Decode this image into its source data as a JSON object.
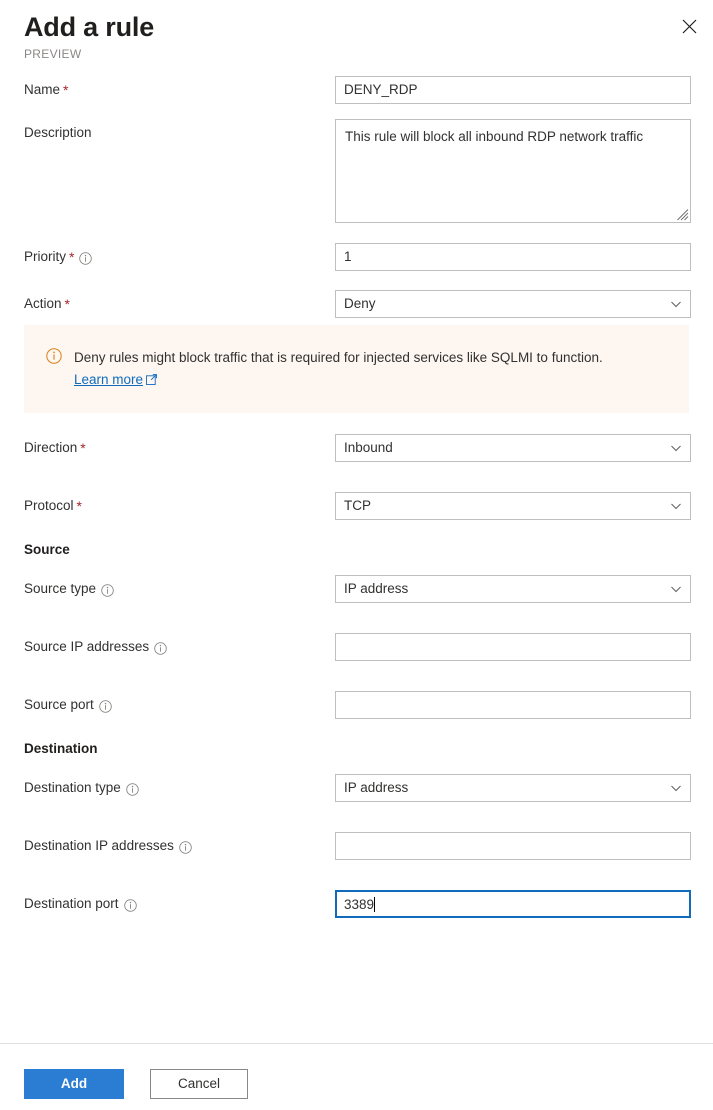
{
  "header": {
    "title": "Add a rule",
    "subtitle": "PREVIEW",
    "close_icon": "close-icon"
  },
  "fields": {
    "name": {
      "label": "Name",
      "required": "*",
      "value": "DENY_RDP"
    },
    "description": {
      "label": "Description",
      "value": "This rule will block all inbound RDP network traffic"
    },
    "priority": {
      "label": "Priority",
      "required": "*",
      "value": "1"
    },
    "action": {
      "label": "Action",
      "required": "*",
      "value": "Deny"
    },
    "direction": {
      "label": "Direction",
      "required": "*",
      "value": "Inbound"
    },
    "protocol": {
      "label": "Protocol",
      "required": "*",
      "value": "TCP"
    },
    "source_type": {
      "label": "Source type",
      "value": "IP address"
    },
    "source_ip": {
      "label": "Source IP addresses",
      "value": ""
    },
    "source_port": {
      "label": "Source port",
      "value": ""
    },
    "destination_type": {
      "label": "Destination type",
      "value": "IP address"
    },
    "destination_ip": {
      "label": "Destination IP addresses",
      "value": ""
    },
    "destination_port": {
      "label": "Destination port",
      "value": "3389",
      "focused": true
    }
  },
  "banner": {
    "icon": "info-icon",
    "text": "Deny rules might block traffic that is required for injected services like SQLMI to function.",
    "link_text": "Learn more",
    "link_icon": "external-link-icon",
    "background_color": "#fdf6f1",
    "icon_color": "#d68216"
  },
  "sections": {
    "source": "Source",
    "destination": "Destination"
  },
  "footer": {
    "add_label": "Add",
    "cancel_label": "Cancel",
    "primary_color": "#2b7cd3"
  }
}
